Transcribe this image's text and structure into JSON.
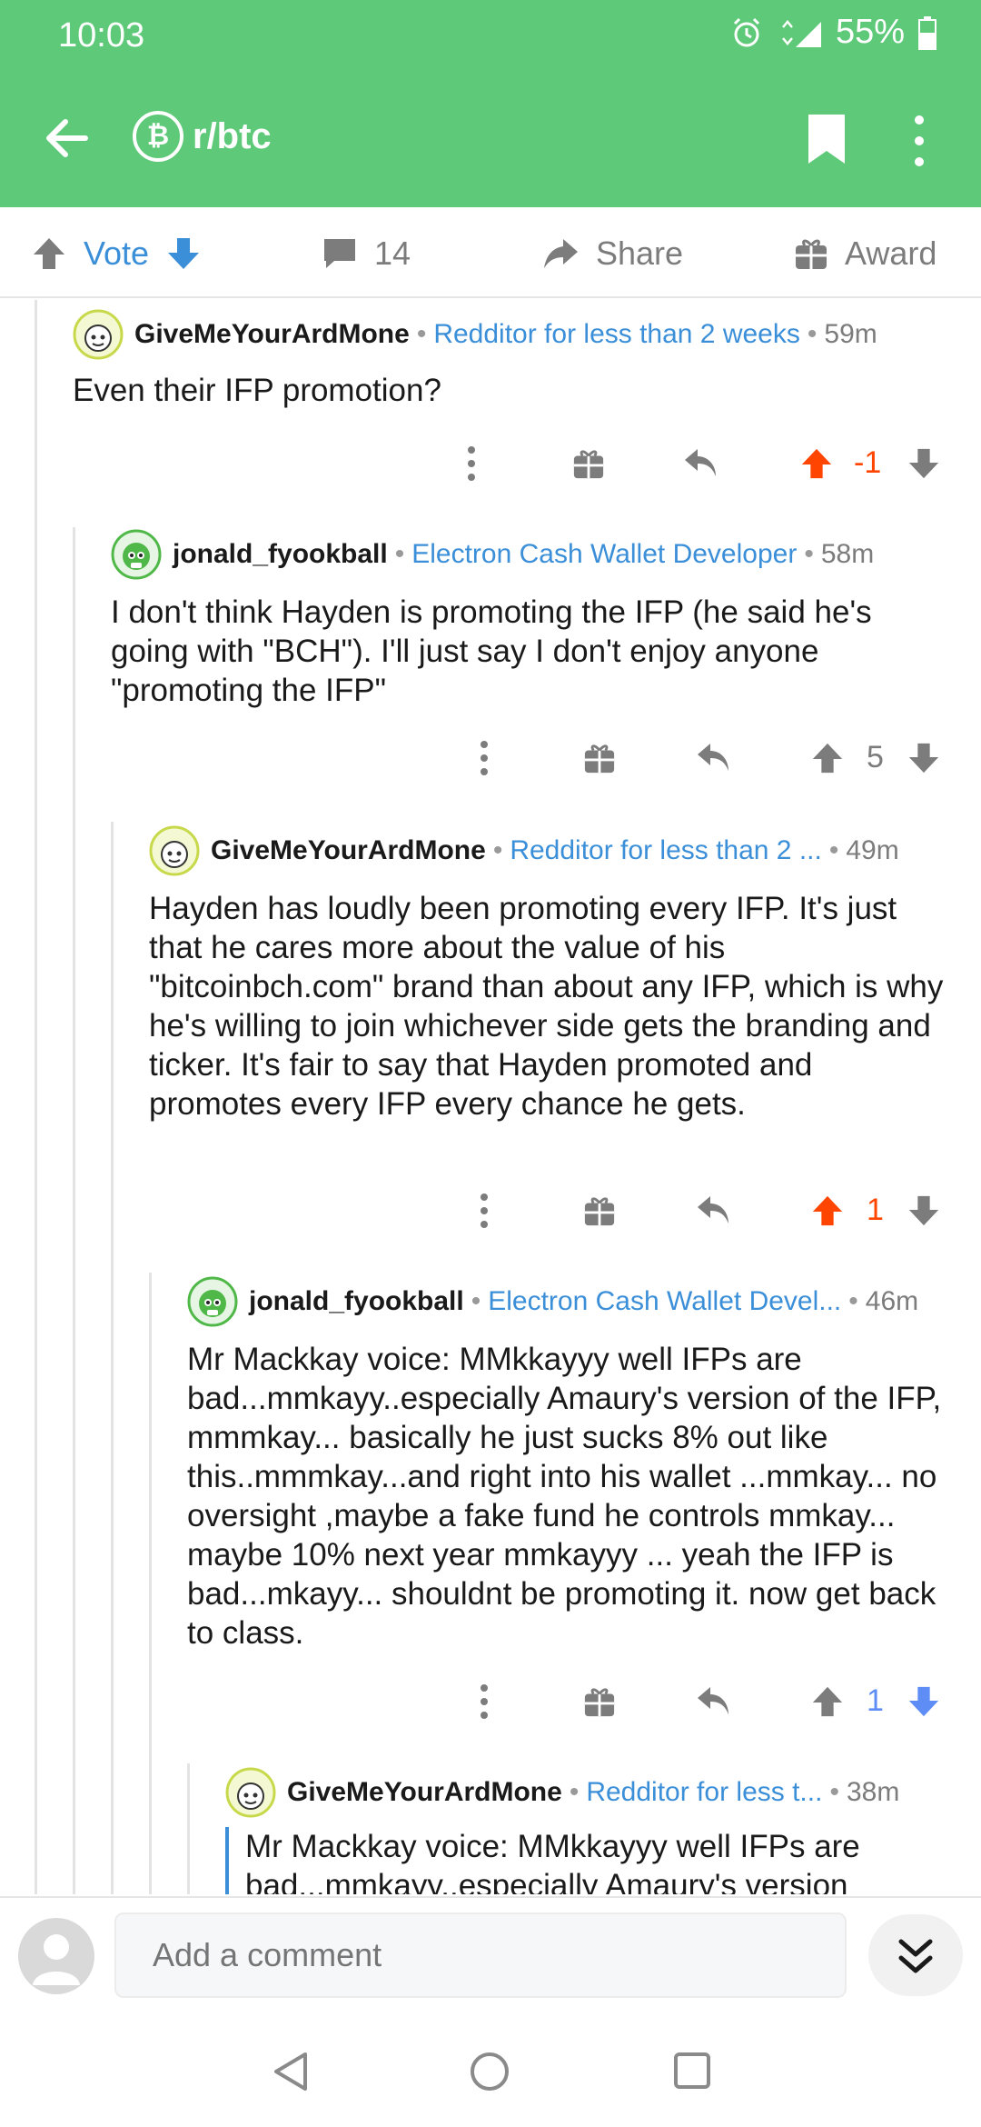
{
  "status": {
    "time": "10:03",
    "network": "4G",
    "battery": "55%"
  },
  "header": {
    "subreddit": "r/btc",
    "sub_icon_glyph": "₿"
  },
  "actions": {
    "vote_label": "Vote",
    "comment_count": "14",
    "share_label": "Share",
    "award_label": "Award"
  },
  "comments": [
    {
      "author": "GiveMeYourArdMone",
      "flair": "Redditor for less than 2 weeks",
      "age": "59m",
      "body": "Even their IFP promotion?",
      "score": "-1"
    },
    {
      "author": "jonald_fyookball",
      "flair": "Electron Cash Wallet Developer",
      "age": "58m",
      "body": "I don't think Hayden is promoting the IFP (he said he's going with \"BCH\").  I'll just say I don't enjoy anyone \"promoting the IFP\"",
      "score": "5"
    },
    {
      "author": "GiveMeYourArdMone",
      "flair": "Redditor for less than 2 ...",
      "age": "49m",
      "body": "Hayden has loudly been promoting every IFP. It's just that he cares more about the value of his \"bitcoinbch.com\" brand than about any IFP, which is why he's willing to join whichever side gets the branding and ticker. It's fair to say that Hayden promoted and promotes every IFP every chance he gets.",
      "score": "1"
    },
    {
      "author": "jonald_fyookball",
      "flair": "Electron Cash Wallet Devel...",
      "age": "46m",
      "body": "Mr Mackkay voice:  MMkkayyy well IFPs are bad...mmkayy..especially Amaury's version of the IFP, mmmkay... basically he just sucks 8% out like this..mmmkay...and right into his wallet ...mmkay... no oversight ,maybe a fake fund he controls mmkay... maybe 10% next year mmkayyy ... yeah the IFP is bad...mkayy... shouldnt be promoting it. now get back to class.",
      "score": "1"
    },
    {
      "author": "GiveMeYourArdMone",
      "flair": "Redditor for less t...",
      "age": "38m",
      "body": "Mr Mackkay voice: MMkkayyy well IFPs are bad...mmkayy..especially Amaury's version"
    }
  ],
  "composer": {
    "placeholder": "Add a comment"
  },
  "colors": {
    "header_green": "#5ec978",
    "flair_blue": "#3b8fd8",
    "upvote_orange": "#ff4500",
    "downvote_blue": "#5d8df5",
    "icon_gray": "#7c7c7c"
  },
  "icons": [
    "back-arrow-icon",
    "bitcoin-icon",
    "bookmark-icon",
    "more-vertical-icon",
    "upvote-icon",
    "downvote-icon",
    "comment-icon",
    "share-icon",
    "award-icon",
    "reply-icon",
    "snoo-avatar-icon",
    "user-avatar-icon",
    "double-chevron-down-icon",
    "nav-back-icon",
    "nav-home-icon",
    "nav-recents-icon"
  ]
}
